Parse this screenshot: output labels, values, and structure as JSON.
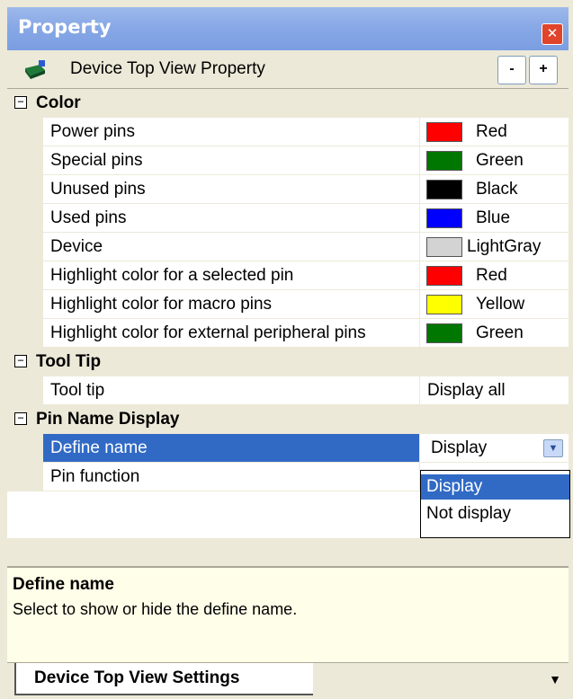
{
  "window": {
    "title": "Property"
  },
  "header": {
    "title": "Device Top View Property",
    "collapse_label": "-",
    "expand_label": "+"
  },
  "categories": {
    "color": {
      "label": "Color",
      "items": [
        {
          "name": "Power pins",
          "value": "Red",
          "color": "#ff0000"
        },
        {
          "name": "Special pins",
          "value": "Green",
          "color": "#007700"
        },
        {
          "name": "Unused pins",
          "value": "Black",
          "color": "#000000"
        },
        {
          "name": "Used pins",
          "value": "Blue",
          "color": "#0000ff"
        },
        {
          "name": "Device",
          "value": "LightGray",
          "color": "#d3d3d3"
        },
        {
          "name": "Highlight color for a selected pin",
          "value": "Red",
          "color": "#ff0000"
        },
        {
          "name": "Highlight color for macro pins",
          "value": "Yellow",
          "color": "#ffff00"
        },
        {
          "name": "Highlight color for external peripheral pins",
          "value": "Green",
          "color": "#007700"
        }
      ]
    },
    "tooltip": {
      "label": "Tool Tip",
      "items": [
        {
          "name": "Tool tip",
          "value": "Display all"
        }
      ]
    },
    "pin_name_display": {
      "label": "Pin Name Display",
      "items": [
        {
          "name": "Define name",
          "value": "Display"
        },
        {
          "name": "Pin function",
          "value": ""
        }
      ]
    }
  },
  "dropdown": {
    "options": [
      "Display",
      "Not display"
    ],
    "selected": "Display"
  },
  "description": {
    "title": "Define name",
    "text": "Select to show or hide the define name."
  },
  "tab": {
    "label": "Device Top View Settings"
  }
}
